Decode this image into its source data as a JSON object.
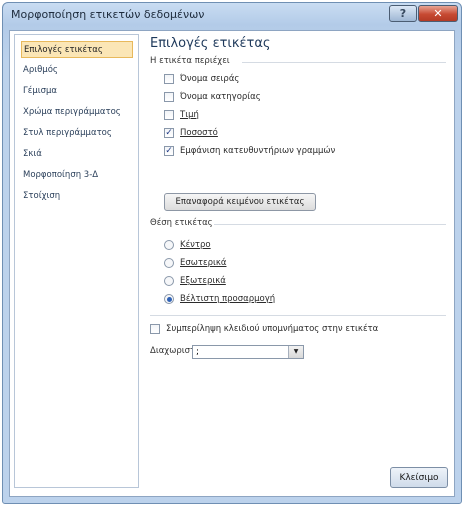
{
  "window": {
    "title": "Μορφοποίηση ετικετών δεδομένων"
  },
  "sidebar": {
    "items": [
      {
        "label": "Επιλογές ετικέτας",
        "selected": true
      },
      {
        "label": "Αριθμός",
        "selected": false
      },
      {
        "label": "Γέμισμα",
        "selected": false
      },
      {
        "label": "Χρώμα περιγράμματος",
        "selected": false
      },
      {
        "label": "Στυλ περιγράμματος",
        "selected": false
      },
      {
        "label": "Σκιά",
        "selected": false
      },
      {
        "label": "Μορφοποίηση 3-Δ",
        "selected": false
      },
      {
        "label": "Στοίχιση",
        "selected": false
      }
    ]
  },
  "main": {
    "heading": "Επιλογές ετικέτας",
    "contains_label": "Η ετικέτα περιέχει",
    "checkboxes": [
      {
        "label": "Όνομα σειράς",
        "checked": false
      },
      {
        "label": "Όνομα κατηγορίας",
        "checked": false
      },
      {
        "label": "Τιμή",
        "checked": false
      },
      {
        "label": "Ποσοστό",
        "checked": true
      },
      {
        "label": "Εμφάνιση κατευθυντήριων γραμμών",
        "checked": true
      }
    ],
    "reset_button": "Επαναφορά κειμένου ετικέτας",
    "position_label": "Θέση ετικέτας",
    "radios": [
      {
        "label": "Κέντρο",
        "checked": false
      },
      {
        "label": "Εσωτερικά",
        "checked": false
      },
      {
        "label": "Εξωτερικά",
        "checked": false
      },
      {
        "label": "Βέλτιστη προσαρμογή",
        "checked": true
      }
    ],
    "legend_key_checkbox": {
      "label": "Συμπερίληψη κλειδιού υπομνήματος στην ετικέτα",
      "checked": false
    },
    "separator_label": "Διαχωριστικό",
    "separator_value": ";"
  },
  "footer": {
    "close_button": "Κλείσιμο"
  },
  "icons": {
    "help": "question-mark",
    "close": "x-mark",
    "check": "✓",
    "dropdown": "▼"
  }
}
